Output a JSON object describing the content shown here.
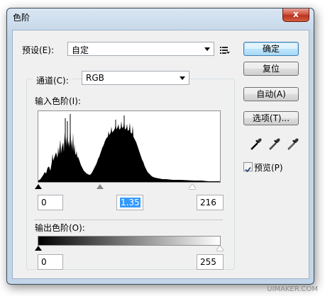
{
  "window": {
    "title": "色阶",
    "close_glyph": "x"
  },
  "preset": {
    "label": "预设(E):",
    "value": "自定",
    "options_icon": "list-menu-icon"
  },
  "channel": {
    "label": "通道(C):",
    "value": "RGB"
  },
  "input_levels": {
    "label": "输入色阶(I):",
    "black": "0",
    "gamma": "1.35",
    "white": "216"
  },
  "output_levels": {
    "label": "输出色阶(O):",
    "black": "0",
    "white": "255"
  },
  "buttons": {
    "ok": "确定",
    "reset": "复位",
    "auto": "自动(A)",
    "options": "选项(T)..."
  },
  "eyedroppers": [
    "black-point-eyedropper-icon",
    "gray-point-eyedropper-icon",
    "white-point-eyedropper-icon"
  ],
  "preview": {
    "label": "预览(P)",
    "checked": true
  },
  "watermark": "UIMAKER.COM"
}
